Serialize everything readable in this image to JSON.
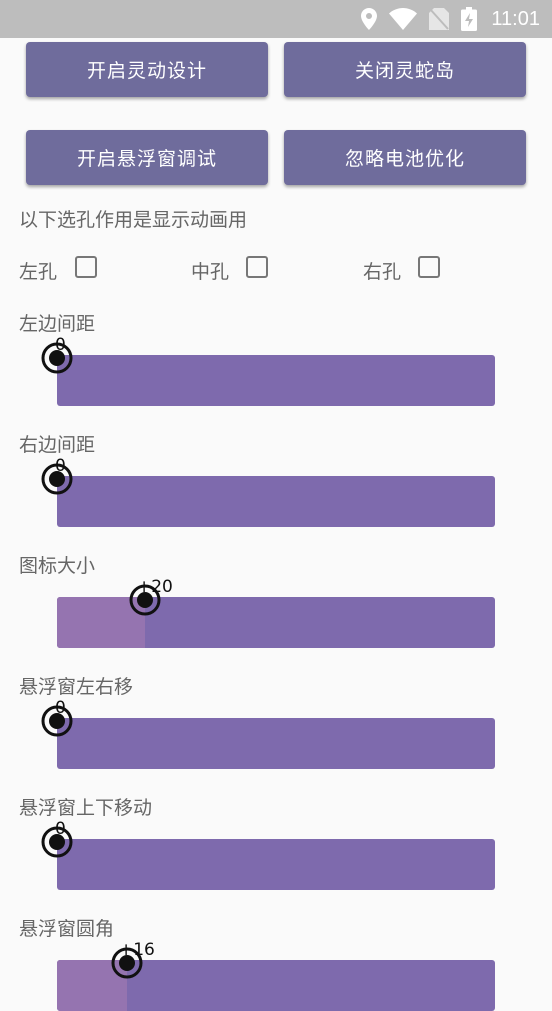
{
  "status_bar": {
    "time": "11:01"
  },
  "buttons": {
    "enable_dynamic": "开启灵动设计",
    "close_snake_island": "关闭灵蛇岛",
    "enable_float_debug": "开启悬浮窗调试",
    "ignore_battery": "忽略电池优化"
  },
  "hole_select": {
    "note": "以下选孔作用是显示动画用",
    "options": [
      {
        "label": "左孔",
        "checked": false
      },
      {
        "label": "中孔",
        "checked": false
      },
      {
        "label": "右孔",
        "checked": false
      }
    ]
  },
  "sliders": [
    {
      "label": "左边间距",
      "value": "0",
      "fraction": 0.0
    },
    {
      "label": "右边间距",
      "value": "0",
      "fraction": 0.0
    },
    {
      "label": "图标大小",
      "value": "+20",
      "fraction": 0.2
    },
    {
      "label": "悬浮窗左右移",
      "value": "0",
      "fraction": 0.0
    },
    {
      "label": "悬浮窗上下移动",
      "value": "0",
      "fraction": 0.0
    },
    {
      "label": "悬浮窗圆角",
      "value": "+16",
      "fraction": 0.16
    }
  ]
}
